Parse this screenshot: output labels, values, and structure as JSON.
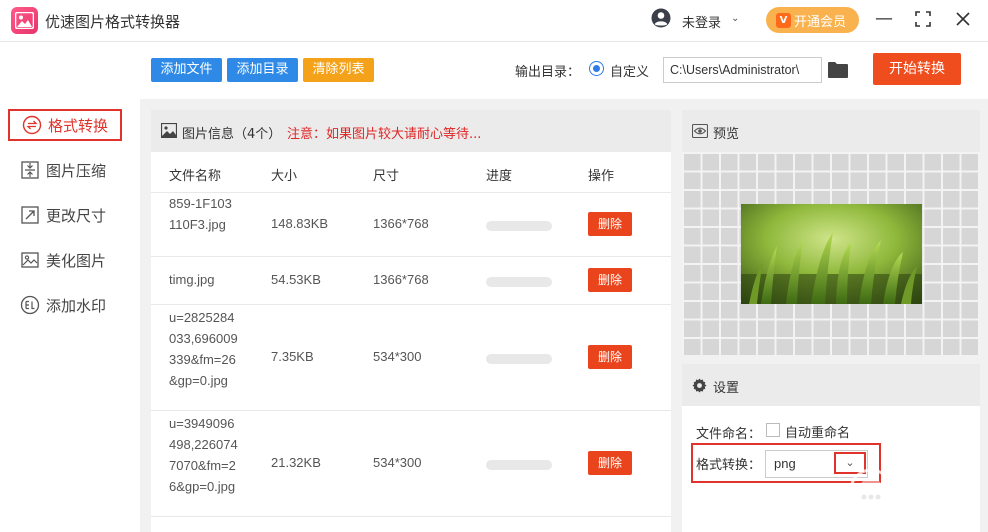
{
  "app": {
    "title": "优速图片格式转换器"
  },
  "user": {
    "login_label": "未登录",
    "vip_label": "开通会员",
    "vip_badge": "V"
  },
  "sidebar": {
    "items": [
      {
        "label": "格式转换",
        "icon": "format-convert-icon",
        "active": true
      },
      {
        "label": "图片压缩",
        "icon": "compress-icon"
      },
      {
        "label": "更改尺寸",
        "icon": "resize-icon"
      },
      {
        "label": "美化图片",
        "icon": "beautify-icon"
      },
      {
        "label": "添加水印",
        "icon": "watermark-icon"
      }
    ]
  },
  "toolbar": {
    "add_file": "添加文件",
    "add_dir": "添加目录",
    "clear_list": "清除列表",
    "output_label": "输出目录：",
    "custom_label": "自定义",
    "output_path": "C:\\Users\\Administrator\\",
    "start_label": "开始转换",
    "colors": {
      "blue": "#2e8ae6",
      "orange": "#f5a21b",
      "red": "#f04d1e"
    }
  },
  "file_list": {
    "title": "图片信息（4个）",
    "note": "注意：如果图片较大请耐心等待...",
    "columns": {
      "name": "文件名称",
      "size": "大小",
      "dims": "尺寸",
      "progress": "进度",
      "action": "操作"
    },
    "rows": [
      {
        "name": "859-1F103110F3.jpg",
        "size": "148.83KB",
        "dims": "1366*768",
        "progress": 0,
        "delete": "删除"
      },
      {
        "name": "timg.jpg",
        "size": "54.53KB",
        "dims": "1366*768",
        "progress": 0,
        "delete": "删除"
      },
      {
        "name": "u=2825284033,696009339&fm=26&gp=0.jpg",
        "size": "7.35KB",
        "dims": "534*300",
        "progress": 0,
        "delete": "删除"
      },
      {
        "name": "u=3949096498,2260747070&fm=26&gp=0.jpg",
        "size": "21.32KB",
        "dims": "534*300",
        "progress": 0,
        "delete": "删除"
      }
    ]
  },
  "preview": {
    "title": "预览"
  },
  "settings": {
    "title": "设置",
    "naming_label": "文件命名：",
    "auto_rename_label": "自动重命名",
    "auto_rename_checked": false,
    "format_label": "格式转换：",
    "format_value": "png"
  },
  "watermark": {
    "cn": "路由器",
    "en": "luyouqi.com"
  }
}
